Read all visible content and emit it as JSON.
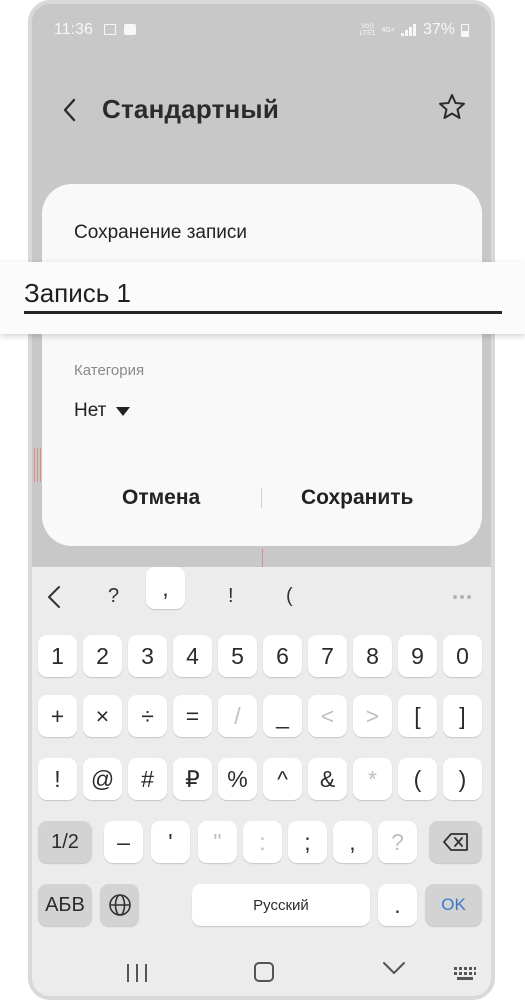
{
  "status_bar": {
    "time": "11:36",
    "volte": "Vo))\nLTE1",
    "network": "4G+",
    "battery": "37%"
  },
  "header": {
    "title": "Стандартный"
  },
  "dialog": {
    "title": "Сохранение записи",
    "name_value": "Запись 1",
    "category_label": "Категория",
    "category_value": "Нет",
    "cancel_label": "Отмена",
    "save_label": "Сохранить"
  },
  "keyboard": {
    "suggest": [
      "?",
      "&",
      "!",
      "("
    ],
    "row1": [
      "1",
      "2",
      "3",
      "4",
      "5",
      "6",
      "7",
      "8",
      "9",
      "0"
    ],
    "row2": [
      "+",
      "×",
      "÷",
      "=",
      "/",
      "_",
      "<",
      ">",
      "[",
      "]"
    ],
    "row3": [
      "!",
      "@",
      "#",
      "₽",
      "%",
      "^",
      "&",
      "*",
      "(",
      ")"
    ],
    "row4": {
      "shift": "1/2",
      "keys": [
        "–",
        "'",
        "\"",
        ":",
        ";",
        ",",
        "?"
      ]
    },
    "row5": {
      "lang_switch": "АБВ",
      "comma": ",",
      "space": "Русский",
      "period": ".",
      "enter": "OK"
    }
  },
  "colors": {
    "ok_key": "#3a79c9",
    "dialog_bg": "#f9f9f9",
    "dim_bg": "#c8c8c8"
  }
}
